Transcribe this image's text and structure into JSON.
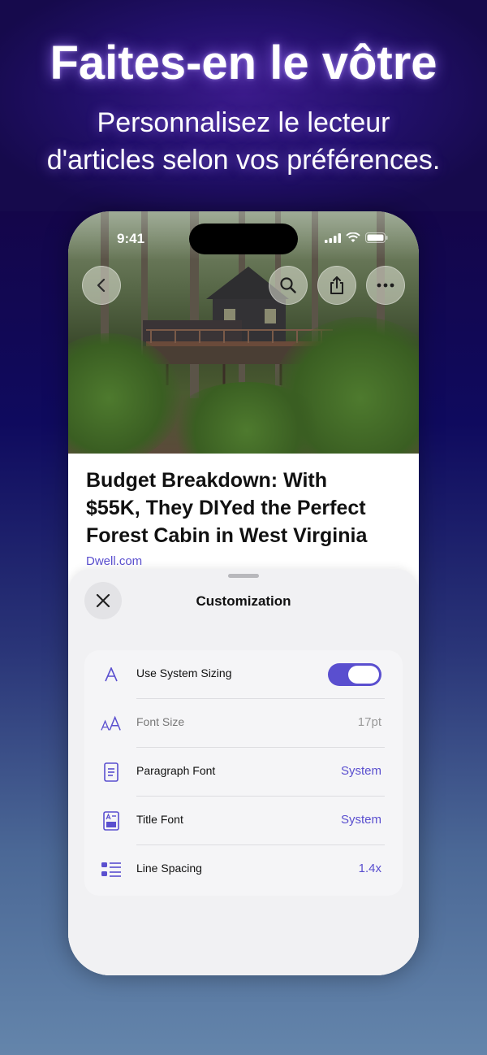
{
  "promo": {
    "headline": "Faites-en le vôtre",
    "subline_line1": "Personnalisez le lecteur",
    "subline_line2": "d'articles selon vos préférences."
  },
  "status_bar": {
    "time": "9:41"
  },
  "article": {
    "title_line1": "Budget Breakdown: With",
    "title_line2": "$55K, They DIYed the Perfect",
    "title_line3": "Forest Cabin in West Virginia",
    "source": "Dwell.com"
  },
  "toolbar": {
    "back_icon": "chevron-left-icon",
    "search_icon": "search-icon",
    "share_icon": "share-icon",
    "more_icon": "more-icon"
  },
  "sheet": {
    "title": "Customization",
    "close_icon": "close-icon",
    "rows": [
      {
        "icon": "letter-a-icon",
        "label": "Use System Sizing",
        "toggle_on": true
      },
      {
        "icon": "font-size-icon",
        "label": "Font Size",
        "value": "17pt"
      },
      {
        "icon": "paragraph-icon",
        "label": "Paragraph Font",
        "value": "System"
      },
      {
        "icon": "title-font-icon",
        "label": "Title Font",
        "value": "System"
      },
      {
        "icon": "line-spacing-icon",
        "label": "Line Spacing",
        "value": "1.4x"
      }
    ]
  },
  "colors": {
    "accent": "#5a4fcf",
    "background_top": "#14064a",
    "background_bottom": "#6485ab"
  }
}
